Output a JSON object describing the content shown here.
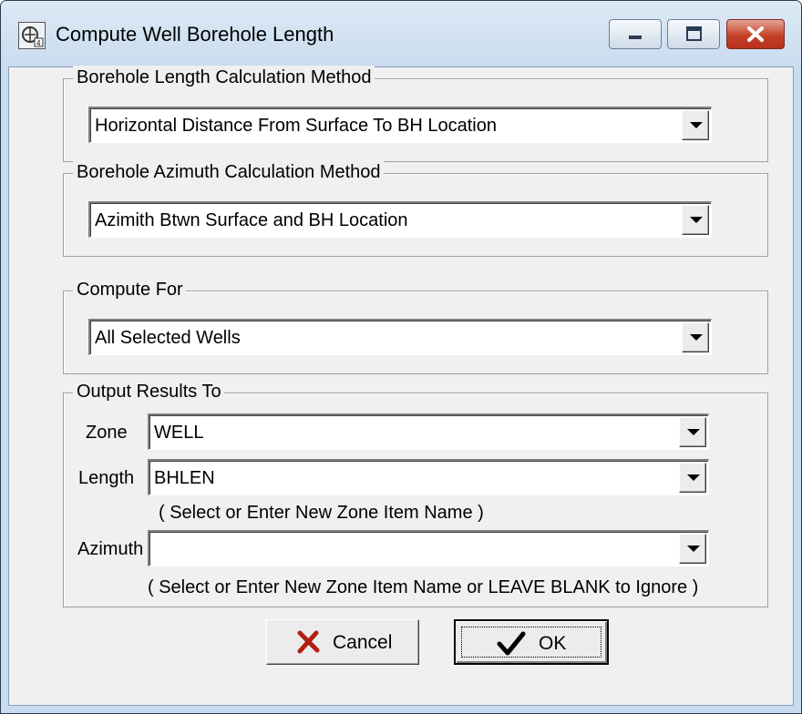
{
  "window": {
    "title": "Compute Well Borehole Length",
    "buttons": [
      "minimize",
      "maximize",
      "close"
    ]
  },
  "groups": {
    "length_method": {
      "legend": "Borehole Length Calculation Method",
      "value": "Horizontal Distance From Surface To BH Location"
    },
    "azimuth_method": {
      "legend": "Borehole Azimuth Calculation Method",
      "value": "Azimith Btwn Surface and BH Location"
    },
    "compute_for": {
      "legend": "Compute For",
      "value": "All Selected Wells"
    },
    "output": {
      "legend": "Output Results To",
      "zone_label": "Zone",
      "zone_value": "WELL",
      "length_label": "Length",
      "length_value": "BHLEN",
      "length_hint": "( Select or Enter New Zone Item Name )",
      "azimuth_label": "Azimuth",
      "azimuth_value": "",
      "azimuth_hint": "( Select or Enter New Zone Item Name or LEAVE BLANK to Ignore )"
    }
  },
  "buttons": {
    "cancel_label": "Cancel",
    "ok_label": "OK"
  },
  "icons": {
    "app": "app-icon",
    "cancel": "red-x-icon",
    "ok": "checkmark-icon",
    "dropdown": "chevron-down-icon"
  },
  "colors": {
    "titlebar": "#c9dcef",
    "close_button": "#c4422a",
    "dialog_background": "#f0f0f0",
    "cancel_icon": "#b22010"
  }
}
